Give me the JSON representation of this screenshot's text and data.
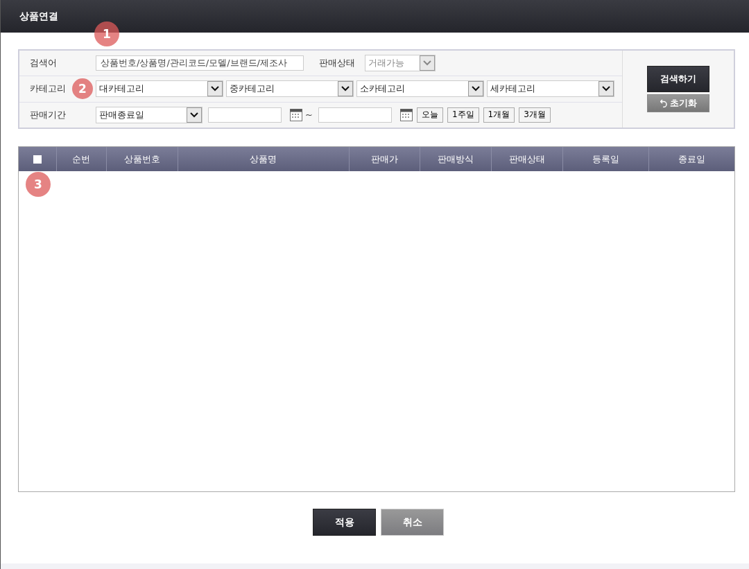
{
  "window": {
    "title": "상품연결"
  },
  "search": {
    "keyword": {
      "label": "검색어",
      "value": "상품번호/상품명/관리코드/모델/브랜드/제조사"
    },
    "status": {
      "label": "판매상태",
      "value": "거래가능",
      "disabled": true
    },
    "category": {
      "label": "카테고리",
      "selects": [
        "대카테고리",
        "중카테고리",
        "소카테고리",
        "세카테고리"
      ]
    },
    "period": {
      "label": "판매기간",
      "type": "판매종료일",
      "separator": "~",
      "quick": [
        "오늘",
        "1주일",
        "1개월",
        "3개월"
      ]
    },
    "search_button": "검색하기",
    "reset_button": "초기화"
  },
  "table": {
    "select_all": {
      "checked": false
    },
    "columns": [
      "순번",
      "상품번호",
      "상품명",
      "판매가",
      "판매방식",
      "판매상태",
      "등록일",
      "종료일"
    ]
  },
  "buttons": [
    {
      "label": "적용",
      "kind": "primary"
    },
    {
      "label": "취소",
      "kind": "secondary"
    }
  ],
  "annotations": [
    "1",
    "2",
    "3"
  ]
}
